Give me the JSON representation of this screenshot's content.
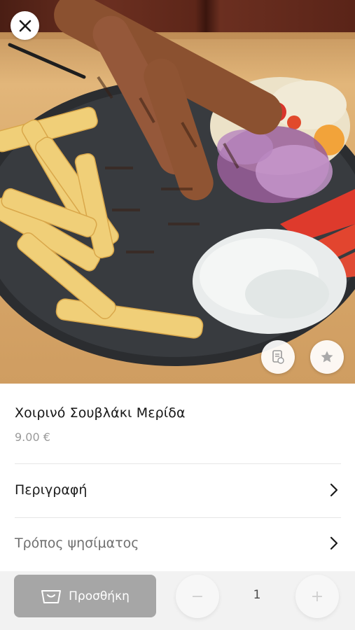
{
  "product": {
    "name": "Χοιρινό Σουβλάκι Μερίδα",
    "price": "9.00 €"
  },
  "sections": [
    {
      "label": "Περιγραφή"
    },
    {
      "label": "Τρόπος ψησίματος"
    }
  ],
  "cart": {
    "add_label": "Προσθήκη",
    "quantity": "1",
    "minus_symbol": "−",
    "plus_symbol": "+"
  },
  "icons": {
    "close": "close-icon",
    "menu": "menu-doc-icon",
    "favorite": "star-icon",
    "basket": "basket-icon",
    "chevron": "chevron-right-icon"
  },
  "colors": {
    "add_button": "#a6a6a6",
    "bottom_bar": "#f2f2f2",
    "price_text": "#9a9a9a"
  }
}
